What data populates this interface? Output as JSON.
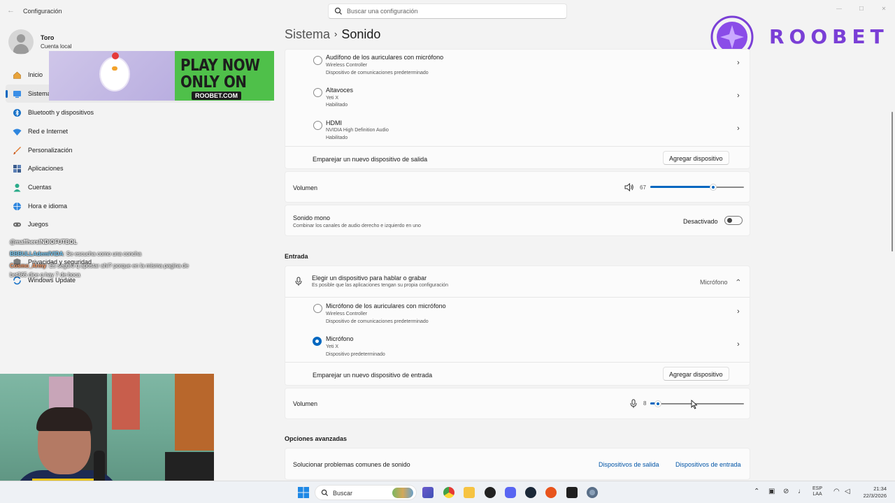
{
  "window": {
    "app_title": "Configuración",
    "search_placeholder": "Buscar una configuración"
  },
  "profile": {
    "name": "Toro",
    "account_type": "Cuenta local"
  },
  "sidebar": {
    "items": [
      {
        "label": "Inicio",
        "icon": "home-icon"
      },
      {
        "label": "Sistema",
        "icon": "system-icon",
        "active": true
      },
      {
        "label": "Bluetooth y dispositivos",
        "icon": "bluetooth-icon"
      },
      {
        "label": "Red e Internet",
        "icon": "wifi-icon"
      },
      {
        "label": "Personalización",
        "icon": "brush-icon"
      },
      {
        "label": "Aplicaciones",
        "icon": "apps-icon"
      },
      {
        "label": "Cuentas",
        "icon": "person-icon"
      },
      {
        "label": "Hora e idioma",
        "icon": "globe-icon"
      },
      {
        "label": "Juegos",
        "icon": "gamepad-icon"
      },
      {
        "label": "Privacidad y seguridad",
        "icon": "shield-icon"
      },
      {
        "label": "Windows Update",
        "icon": "update-icon"
      }
    ]
  },
  "ad": {
    "line1": "PLAY NOW",
    "line2": "ONLY ON",
    "line3": "ROOBET.COM"
  },
  "chat": [
    {
      "user": "@maffhersINDIOFUTBOL",
      "text": ""
    },
    {
      "user": "BBBULLAdemIVIDA",
      "text": ": Se escucha como una concha"
    },
    {
      "user": "Cosmo_Army",
      "text": ": Es seguro q apostar ahí? porque en la misma pagina de"
    },
    {
      "user": "",
      "text": "bet365 dice q hay 7 de boca"
    }
  ],
  "breadcrumb": {
    "parent": "Sistema",
    "separator": "›",
    "current": "Sonido"
  },
  "output": {
    "devices": [
      {
        "name": "Audífono de los auriculares con micrófono",
        "detail": "Wireless Controller",
        "status": "Dispositivo de comunicaciones predeterminado",
        "selected": false
      },
      {
        "name": "Altavoces",
        "detail": "Yeti X",
        "status": "Habilitado",
        "selected": false
      },
      {
        "name": "HDMI",
        "detail": "NVIDIA High Definition Audio",
        "status": "Habilitado",
        "selected": false
      }
    ],
    "pair_label": "Emparejar un nuevo dispositivo de salida",
    "add_button": "Agregar dispositivo",
    "volume_label": "Volumen",
    "volume_value": "67",
    "volume_fraction": 0.67
  },
  "mono": {
    "title": "Sonido mono",
    "subtitle": "Combinar los canales de audio derecho e izquierdo en uno",
    "state_label": "Desactivado",
    "on": false
  },
  "input": {
    "section_title": "Entrada",
    "chooser_title": "Elegir un dispositivo para hablar o grabar",
    "chooser_subtitle": "Es posible que las aplicaciones tengan su propia configuración",
    "chooser_value": "Micrófono",
    "devices": [
      {
        "name": "Micrófono de los auriculares con micrófono",
        "detail": "Wireless Controller",
        "status": "Dispositivo de comunicaciones predeterminado",
        "selected": false
      },
      {
        "name": "Micrófono",
        "detail": "Yeti X",
        "status": "Dispositivo predeterminado",
        "selected": true
      }
    ],
    "pair_label": "Emparejar un nuevo dispositivo de entrada",
    "add_button": "Agregar dispositivo",
    "volume_label": "Volumen",
    "volume_value": "8",
    "volume_fraction": 0.08
  },
  "advanced": {
    "section_title": "Opciones avanzadas",
    "troubleshoot_label": "Solucionar problemas comunes de sonido",
    "link_output": "Dispositivos de salida",
    "link_input": "Dispositivos de entrada"
  },
  "brand": {
    "name": "ROOBET",
    "color": "#7a3fd6"
  },
  "taskbar": {
    "search_label": "Buscar",
    "lang_line1": "ESP",
    "lang_line2": "LAA",
    "time": "21:34",
    "date": "22/3/2026"
  },
  "colors": {
    "accent": "#0067c0",
    "background": "#f3f3f3",
    "card": "#fbfbfb"
  }
}
